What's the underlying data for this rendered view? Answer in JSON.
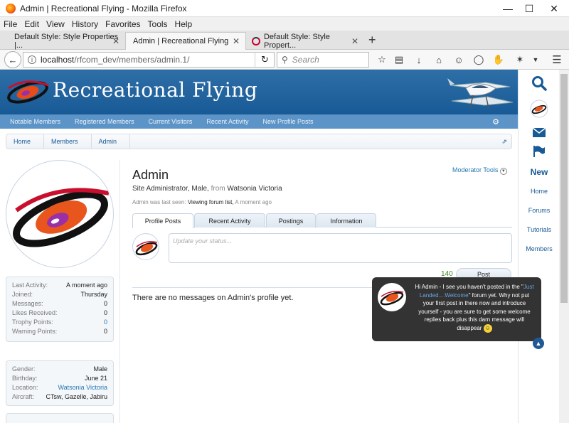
{
  "window": {
    "title": "Admin | Recreational Flying - Mozilla Firefox"
  },
  "menu": [
    "File",
    "Edit",
    "View",
    "History",
    "Favorites",
    "Tools",
    "Help"
  ],
  "tabs": [
    {
      "label": "Default Style: Style Properties |..."
    },
    {
      "label": "Admin | Recreational Flying"
    },
    {
      "label": "Default Style: Style Propert..."
    }
  ],
  "address": {
    "host": "localhost",
    "path": "/rfcom_dev/members/admin.1/"
  },
  "search": {
    "placeholder": "Search"
  },
  "site": {
    "brand": "Recreational Flying",
    "subnav": [
      "Notable Members",
      "Registered Members",
      "Current Visitors",
      "Recent Activity",
      "New Profile Posts"
    ],
    "breadcrumbs": [
      "Home",
      "Members",
      "Admin"
    ]
  },
  "profile": {
    "name": "Admin",
    "title_prefix": "Site Administrator, Male,",
    "from_label": "from",
    "location": "Watsonia Victoria",
    "moderator_tools": "Moderator Tools",
    "last_seen_label": "Admin was last seen:",
    "last_seen_value": "Viewing forum list,",
    "last_seen_time": "A moment ago",
    "tabs": [
      "Profile Posts",
      "Recent Activity",
      "Postings",
      "Information"
    ],
    "status_placeholder": "Update your status...",
    "char_count": "140",
    "post_button": "Post",
    "no_messages": "There are no messages on Admin's profile yet."
  },
  "stats": [
    {
      "k": "Last Activity:",
      "v": "A moment ago"
    },
    {
      "k": "Joined:",
      "v": "Thursday"
    },
    {
      "k": "Messages:",
      "v": "0"
    },
    {
      "k": "Likes Received:",
      "v": "0"
    },
    {
      "k": "Trophy Points:",
      "v": "0"
    },
    {
      "k": "Warning Points:",
      "v": "0"
    }
  ],
  "info": [
    {
      "k": "Gender:",
      "v": "Male"
    },
    {
      "k": "Birthday:",
      "v": "June 21"
    },
    {
      "k": "Location:",
      "v": "Watsonia Victoria"
    },
    {
      "k": "Aircraft:",
      "v": "CTsw, Gazelle, Jabiru"
    }
  ],
  "right_sidebar": {
    "new_label": "New",
    "links": [
      "Home",
      "Forums",
      "Tutorials",
      "Members"
    ]
  },
  "popup": {
    "line1": "Hi Admin - I see you haven't posted in the",
    "link": "Just Landed....Welcome",
    "line2": "forum yet. Why not put your first post in there now and introduce yourself - you are sure to get some welcome replies back plus this darn message will disappear"
  },
  "colors": {
    "banner": "#185a96",
    "subnav": "#5d94c7",
    "link": "#2577b1"
  }
}
